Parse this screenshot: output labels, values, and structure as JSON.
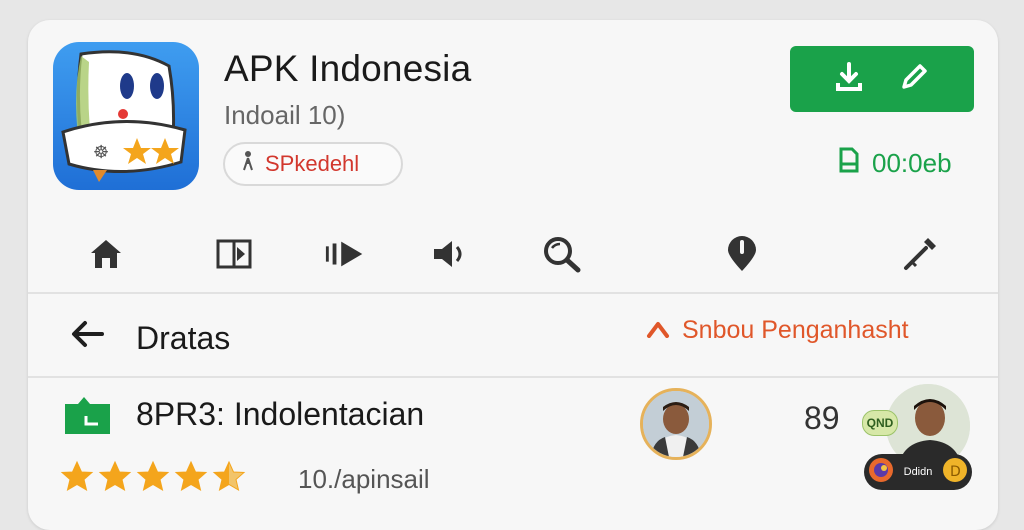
{
  "app": {
    "title": "APK Indonesia",
    "subtitle": "Indoail 10)",
    "developer_chip": "SPkedehl",
    "size": "00:0eb"
  },
  "colors": {
    "accent_green": "#1aa24a",
    "report_orange": "#e0572a",
    "developer_red": "#d2372d",
    "star_gold": "#f4a51c",
    "icon_blue": "#1f6fd6"
  },
  "icons": {
    "install": [
      "download-icon",
      "edit-icon"
    ],
    "size": "file-icon",
    "developer": "person-icon",
    "actions": [
      "home-icon",
      "split-view-icon",
      "media-icon",
      "volume-icon",
      "search-icon",
      "location-icon",
      "tools-icon"
    ],
    "back": "arrow-left-icon",
    "report": "caret-up-icon",
    "review": "chat-icon"
  },
  "nav": {
    "section_title": "Dratas",
    "report_label": "Snbou Penganhasht"
  },
  "review": {
    "title": "8PR3: Indolentacian",
    "count": "89",
    "rating": 4.5,
    "rating_max": 5,
    "rating_label": "10./apinsail",
    "badge_top": "QND",
    "badge_bottom": "Ddidn"
  }
}
